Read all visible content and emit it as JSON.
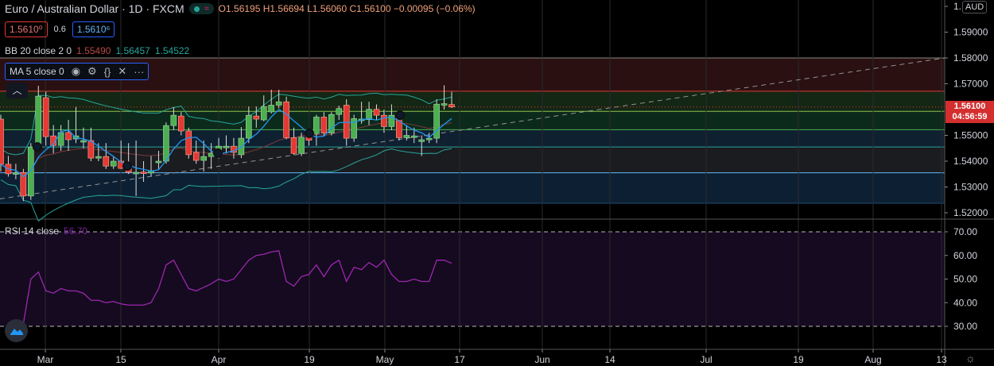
{
  "header": {
    "title": "Euro / Australian Dollar · 1D · FXCM",
    "ohlc": "O1.56195 H1.56694 L1.56060 C1.56100 −0.00095 (−0.06%)",
    "sell_price": "1.5610⁰",
    "spread": "0.6",
    "buy_price": "1.5610⁶",
    "currency_button": "AUD"
  },
  "indicators": {
    "bb": {
      "label": "BB 20 close 2 0",
      "basis": "1.55490",
      "upper": "1.56457",
      "lower": "1.54522"
    },
    "ma": {
      "label": "MA 5 close 0"
    },
    "rsi": {
      "label": "RSI 14 close",
      "value": "56.70"
    }
  },
  "price_axis": {
    "ticks": [
      "1.",
      "1.59000",
      "1.58000",
      "1.57000",
      "1.55000",
      "1.54000",
      "1.53000",
      "1.52000"
    ],
    "last_price": "1.56100",
    "countdown": "04:56:59"
  },
  "rsi_axis": {
    "ticks": [
      "70.00",
      "60.00",
      "50.00",
      "40.00",
      "30.00"
    ]
  },
  "time_axis": {
    "labels": [
      "Mar",
      "15",
      "Apr",
      "19",
      "May",
      "17",
      "Jun",
      "14",
      "Jul",
      "19",
      "Aug",
      "13"
    ]
  },
  "colors": {
    "up": "#4caf50",
    "down": "#e53935",
    "ma": "#2196f3",
    "bb": "#26a69a",
    "rsi": "#9c27b0",
    "last": "#d32f2f"
  },
  "chart_data": {
    "type": "candlestick",
    "candles": [
      [
        1.5563,
        1.558,
        1.536,
        1.5388
      ],
      [
        1.5388,
        1.542,
        1.534,
        1.5351
      ],
      [
        1.5352,
        1.539,
        1.533,
        1.5355
      ],
      [
        1.5356,
        1.537,
        1.5245,
        1.5265
      ],
      [
        1.5265,
        1.547,
        1.525,
        1.5455
      ],
      [
        1.5452,
        1.5692,
        1.544,
        1.5652
      ],
      [
        1.5646,
        1.567,
        1.546,
        1.5495
      ],
      [
        1.5498,
        1.554,
        1.543,
        1.5461
      ],
      [
        1.5461,
        1.554,
        1.544,
        1.5511
      ],
      [
        1.5511,
        1.556,
        1.544,
        1.5483
      ],
      [
        1.5486,
        1.561,
        1.547,
        1.5498
      ],
      [
        1.548,
        1.553,
        1.545,
        1.548
      ],
      [
        1.548,
        1.553,
        1.54,
        1.5412
      ],
      [
        1.5415,
        1.547,
        1.54,
        1.5418
      ],
      [
        1.5418,
        1.547,
        1.537,
        1.5381
      ],
      [
        1.5381,
        1.542,
        1.537,
        1.54
      ],
      [
        1.54,
        1.548,
        1.537,
        1.5372
      ],
      [
        1.5372,
        1.547,
        1.535,
        1.5357
      ],
      [
        1.5357,
        1.548,
        1.5265,
        1.5357
      ],
      [
        1.5358,
        1.54,
        1.532,
        1.5357
      ],
      [
        1.5354,
        1.542,
        1.534,
        1.5363
      ],
      [
        1.54,
        1.544,
        1.537,
        1.54
      ],
      [
        1.54,
        1.555,
        1.539,
        1.5538
      ],
      [
        1.5538,
        1.561,
        1.552,
        1.5578
      ],
      [
        1.5575,
        1.559,
        1.55,
        1.5517
      ],
      [
        1.5517,
        1.553,
        1.541,
        1.5425
      ],
      [
        1.5434,
        1.548,
        1.539,
        1.5403
      ],
      [
        1.5403,
        1.548,
        1.536,
        1.5418
      ],
      [
        1.5418,
        1.547,
        1.537,
        1.5431
      ],
      [
        1.5431,
        1.549,
        1.541,
        1.5458
      ],
      [
        1.5455,
        1.55,
        1.543,
        1.5458
      ],
      [
        1.5458,
        1.549,
        1.541,
        1.5434
      ],
      [
        1.5425,
        1.5532,
        1.5412,
        1.5489
      ],
      [
        1.5489,
        1.5612,
        1.547,
        1.5578
      ],
      [
        1.5575,
        1.5612,
        1.553,
        1.5563
      ],
      [
        1.556,
        1.5655,
        1.5555,
        1.5612
      ],
      [
        1.5591,
        1.5677,
        1.5585,
        1.5617
      ],
      [
        1.5617,
        1.5677,
        1.5605,
        1.563
      ],
      [
        1.563,
        1.565,
        1.5485,
        1.5491
      ],
      [
        1.5491,
        1.553,
        1.5425,
        1.543
      ],
      [
        1.543,
        1.551,
        1.542,
        1.5493
      ],
      [
        1.5493,
        1.552,
        1.546,
        1.5481
      ],
      [
        1.5507,
        1.558,
        1.546,
        1.5571
      ],
      [
        1.5571,
        1.559,
        1.55,
        1.5509
      ],
      [
        1.5509,
        1.559,
        1.55,
        1.5581
      ],
      [
        1.5581,
        1.5615,
        1.556,
        1.5604
      ],
      [
        1.5617,
        1.564,
        1.546,
        1.5489
      ],
      [
        1.5489,
        1.558,
        1.5475,
        1.5565
      ],
      [
        1.5563,
        1.563,
        1.5545,
        1.5563
      ],
      [
        1.5561,
        1.563,
        1.554,
        1.5601
      ],
      [
        1.5601,
        1.562,
        1.556,
        1.5578
      ],
      [
        1.5578,
        1.56,
        1.551,
        1.5534
      ],
      [
        1.5534,
        1.562,
        1.552,
        1.5578
      ],
      [
        1.5578,
        1.5585,
        1.548,
        1.5491
      ],
      [
        1.5491,
        1.554,
        1.548,
        1.55
      ],
      [
        1.5498,
        1.553,
        1.547,
        1.5498
      ],
      [
        1.5476,
        1.55,
        1.542,
        1.5483
      ],
      [
        1.5483,
        1.551,
        1.547,
        1.5489
      ],
      [
        1.5489,
        1.564,
        1.547,
        1.5621
      ],
      [
        1.5621,
        1.5694,
        1.56,
        1.5623
      ],
      [
        1.56195,
        1.56694,
        1.5606,
        1.561
      ]
    ],
    "rsi": [
      null,
      null,
      30,
      31,
      50,
      53,
      45,
      44,
      46,
      45,
      45,
      44,
      41,
      41,
      40,
      40.5,
      39.5,
      39,
      39,
      39,
      40,
      46,
      56,
      58,
      52,
      46,
      45,
      46.5,
      48,
      50,
      49,
      50,
      54,
      58,
      60,
      60.5,
      61.5,
      62,
      49,
      47,
      51,
      52,
      56,
      51,
      56,
      58,
      49,
      55,
      54,
      57,
      55,
      58,
      52,
      49,
      49,
      50,
      49,
      49,
      58,
      58,
      56.7
    ],
    "price_range": [
      1.517,
      1.602
    ],
    "rsi_range": [
      25,
      75
    ],
    "zones": [
      1.58,
      1.5671,
      1.5593,
      1.5522,
      1.5455,
      1.5355,
      1.5237
    ],
    "trendline": [
      [
        0,
        1.5254
      ],
      [
        1,
        1.58
      ]
    ]
  }
}
